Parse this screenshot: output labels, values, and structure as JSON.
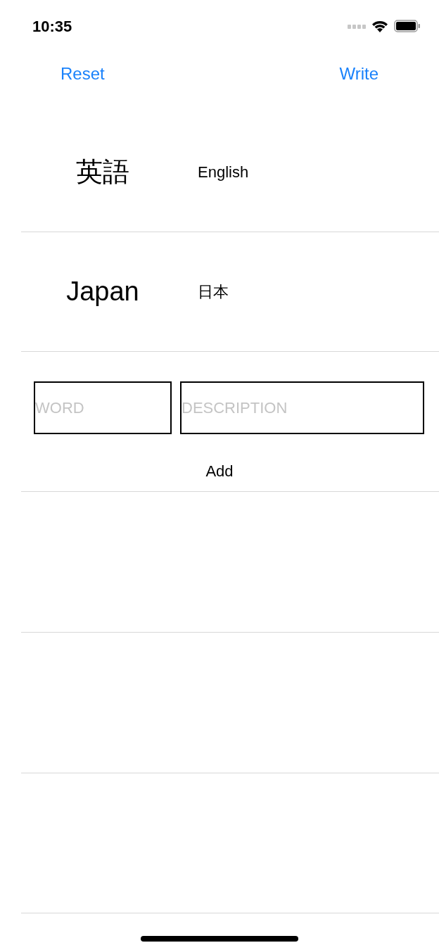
{
  "status_bar": {
    "time": "10:35"
  },
  "nav": {
    "left_button": "Reset",
    "right_button": "Write"
  },
  "rows": [
    {
      "word": "英語",
      "description": "English"
    },
    {
      "word": "Japan",
      "description": "日本"
    }
  ],
  "form": {
    "word_placeholder": "WORD",
    "description_placeholder": "DESCRIPTION",
    "add_button": "Add"
  }
}
